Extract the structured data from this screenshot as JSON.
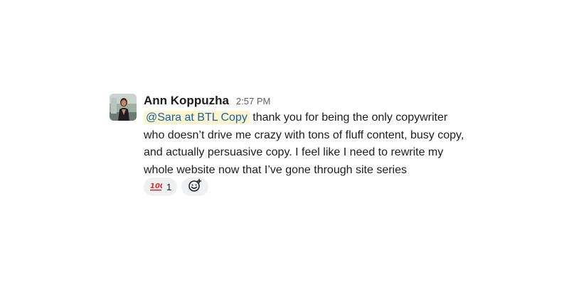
{
  "message": {
    "sender": "Ann Koppuzha",
    "timestamp": "2:57 PM",
    "mention": "@Sara at BTL Copy",
    "text": " thank you for being the only copywriter who doesn’t drive me crazy with tons of fluff content, busy copy, and actually persuasive copy. I feel like I need to rewrite my whole website now that I’ve gone through site series",
    "reactions": [
      {
        "emoji": "100-icon",
        "glyph": "💯",
        "count": "1"
      }
    ],
    "add_reaction_icon": "add-reaction-smiley-icon"
  },
  "colors": {
    "mention_bg": "#fdf3cf",
    "mention_text": "#1264a3",
    "text": "#1d1c1d",
    "muted": "#616061",
    "pill_bg": "#eef0f1"
  }
}
